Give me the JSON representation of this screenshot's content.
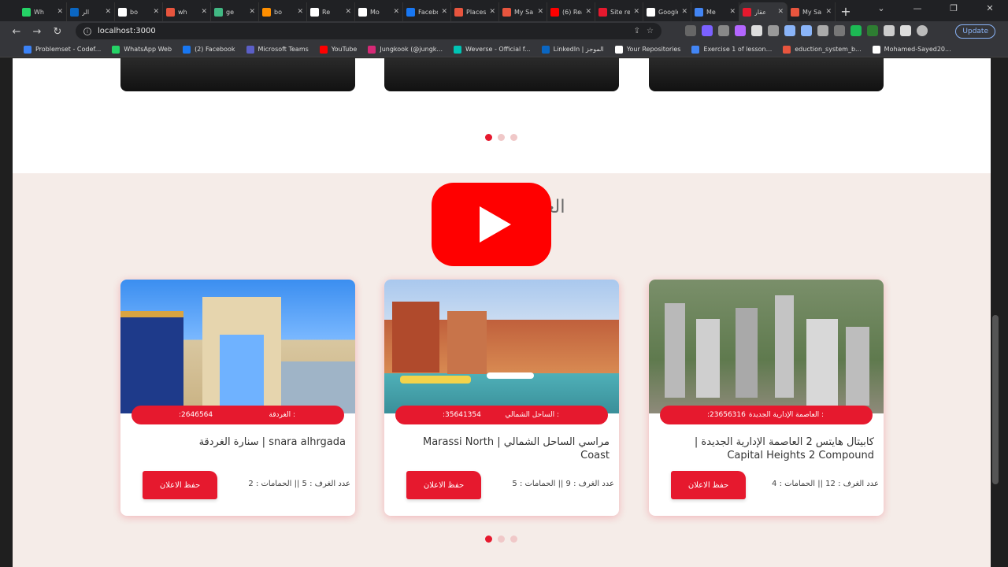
{
  "browser": {
    "tabs": [
      {
        "label": "Wh",
        "color": "#25d366"
      },
      {
        "label": "الر",
        "color": "#0a66c2"
      },
      {
        "label": "bo",
        "color": "#ffffff"
      },
      {
        "label": "wh",
        "color": "#e8553e"
      },
      {
        "label": "ge",
        "color": "#41b883"
      },
      {
        "label": "bo",
        "color": "#ff8f00"
      },
      {
        "label": "Re",
        "color": "#ffffff"
      },
      {
        "label": "Mo",
        "color": "#ffffff"
      },
      {
        "label": "Facebo",
        "color": "#1877f2"
      },
      {
        "label": "Places",
        "color": "#e8553e"
      },
      {
        "label": "My Sa",
        "color": "#e8553e"
      },
      {
        "label": "(6) Rea",
        "color": "#ff0000"
      },
      {
        "label": "Site re",
        "color": "#e6192e"
      },
      {
        "label": "Google",
        "color": "#ffffff"
      },
      {
        "label": "Me",
        "color": "#4285f4"
      },
      {
        "label": "عقار",
        "color": "#e6192e",
        "active": true
      },
      {
        "label": "My Sa",
        "color": "#e8553e"
      }
    ],
    "new_tab": "+",
    "url": "localhost:3000",
    "update_label": "Update",
    "bookmarks": [
      {
        "label": "Problemset - Codef...",
        "color": "#3b82f6"
      },
      {
        "label": "WhatsApp Web",
        "color": "#25d366"
      },
      {
        "label": "(2) Facebook",
        "color": "#1877f2"
      },
      {
        "label": "Microsoft Teams",
        "color": "#5b5fc7"
      },
      {
        "label": "YouTube",
        "color": "#ff0000"
      },
      {
        "label": "Jungkook (@jungk...",
        "color": "#d62976"
      },
      {
        "label": "Weverse - Official f...",
        "color": "#00c4b4"
      },
      {
        "label": "LinkedIn | الموجز",
        "color": "#0a66c2"
      },
      {
        "label": "Your Repositories",
        "color": "#ffffff"
      },
      {
        "label": "Exercise 1 of lesson...",
        "color": "#4285f4"
      },
      {
        "label": "eduction_system_b...",
        "color": "#e8553e"
      },
      {
        "label": "Mohamed-Sayed20...",
        "color": "#ffffff"
      }
    ]
  },
  "page": {
    "section_title": "العقارات المميزة",
    "accent": "#e6192e",
    "cards": [
      {
        "location": ": الغردقة",
        "code": "2646564:",
        "title": "snara alhrgada | سنارة الغردقة",
        "rooms": "عدد الغرف : 5 || الحمامات : 2",
        "save_label": "حفظ الاعلان"
      },
      {
        "location": ": الساحل الشمالي",
        "code": "35641354:",
        "title": "مراسي الساحل الشمالي | Marassi North Coast",
        "rooms": "عدد الغرف : 9 || الحمامات : 5",
        "save_label": "حفظ الاعلان"
      },
      {
        "location": ": العاصمة الإدارية الجديدة",
        "code": "23656316:",
        "title": "كابيتال هايتس 2 العاصمة الإدارية الجديدة | Capital Heights 2 Compound",
        "rooms": "عدد الغرف : 12 || الحمامات : 4",
        "save_label": "حفظ الاعلان"
      }
    ]
  }
}
